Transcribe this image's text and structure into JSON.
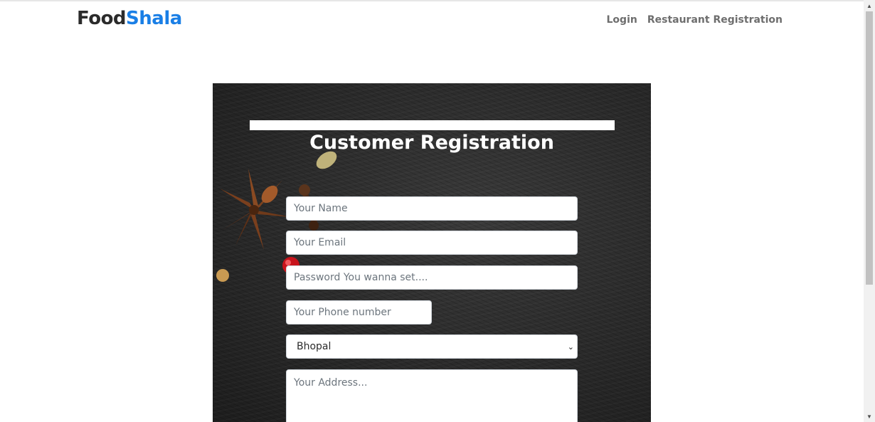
{
  "navbar": {
    "brand_part1": "Food",
    "brand_part2": "Shala",
    "links": [
      "Login",
      "Restaurant Registration"
    ]
  },
  "form": {
    "title": "Customer Registration",
    "name_placeholder": "Your Name",
    "email_placeholder": "Your Email",
    "password_placeholder": "Password You wanna set....",
    "phone_placeholder": "Your Phone number",
    "city_selected": "Bhopal",
    "address_placeholder": "Your Address..."
  },
  "colors": {
    "brand_accent": "#1a7fe6",
    "brand_dark": "#2b2b2b",
    "nav_link": "#6e6e6e",
    "panel_background": "#2a2a2a"
  },
  "icons": {
    "select_chevron": "chevron-down-icon",
    "scroll_up": "arrow-up-icon",
    "scroll_down": "arrow-down-icon"
  }
}
